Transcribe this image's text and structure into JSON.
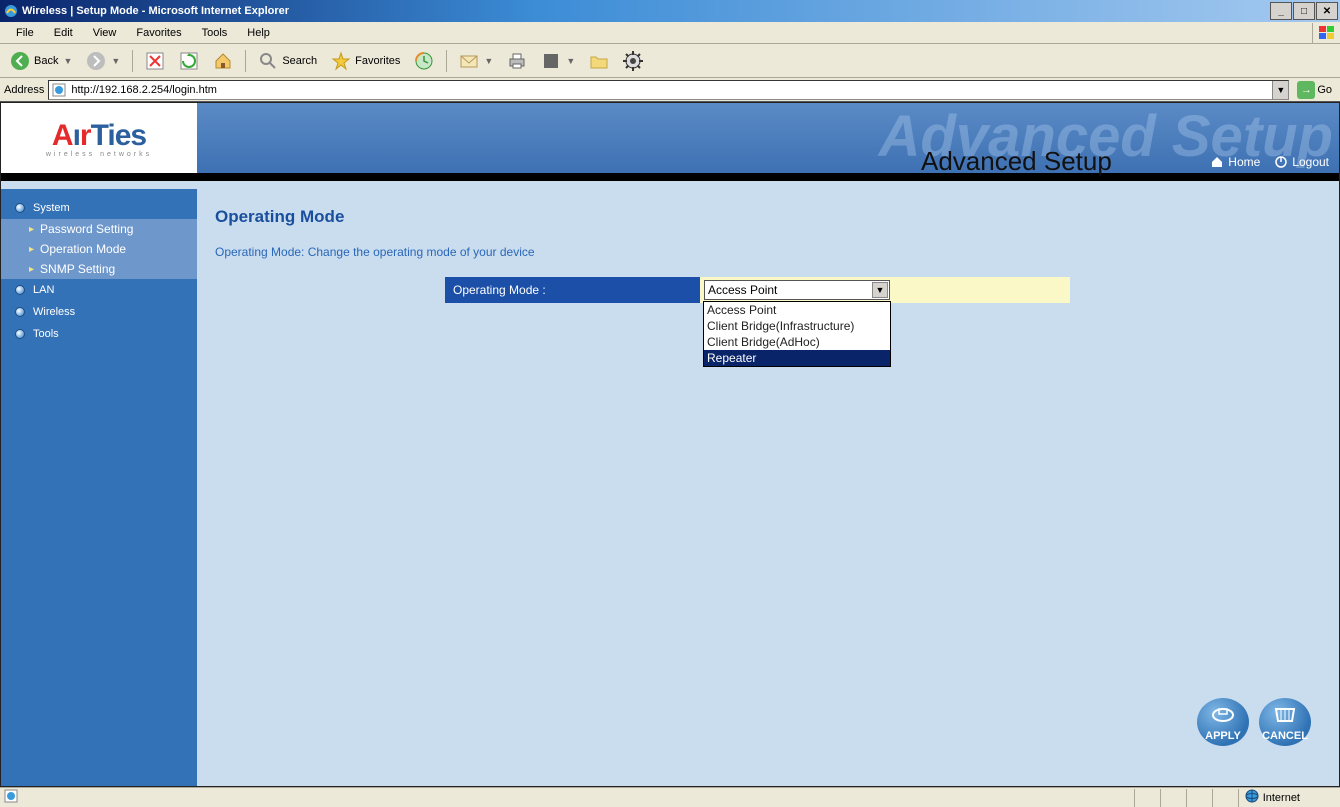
{
  "window": {
    "title": "Wireless | Setup Mode - Microsoft Internet Explorer"
  },
  "menubar": {
    "file": "File",
    "edit": "Edit",
    "view": "View",
    "favorites": "Favorites",
    "tools": "Tools",
    "help": "Help"
  },
  "toolbar": {
    "back": "Back",
    "search": "Search",
    "favorites": "Favorites"
  },
  "addressbar": {
    "label": "Address",
    "url": "http://192.168.2.254/login.htm",
    "go": "Go"
  },
  "banner": {
    "logo_sub": "wireless networks",
    "advanced": "Advanced Setup",
    "ghost": "Advanced Setup",
    "home": "Home",
    "logout": "Logout"
  },
  "sidebar": {
    "system": "System",
    "password_setting": "Password Setting",
    "operation_mode": "Operation Mode",
    "snmp_setting": "SNMP Setting",
    "lan": "LAN",
    "wireless": "Wireless",
    "tools": "Tools"
  },
  "page": {
    "title": "Operating Mode",
    "desc": "Operating Mode: Change the operating mode of your device",
    "form_label": "Operating Mode :",
    "selected_value": "Access Point",
    "options": {
      "ap": "Access Point",
      "cb_infra": "Client Bridge(Infrastructure)",
      "cb_adhoc": "Client Bridge(AdHoc)",
      "repeater": "Repeater"
    },
    "apply": "APPLY",
    "cancel": "CANCEL"
  },
  "statusbar": {
    "zone": "Internet"
  }
}
